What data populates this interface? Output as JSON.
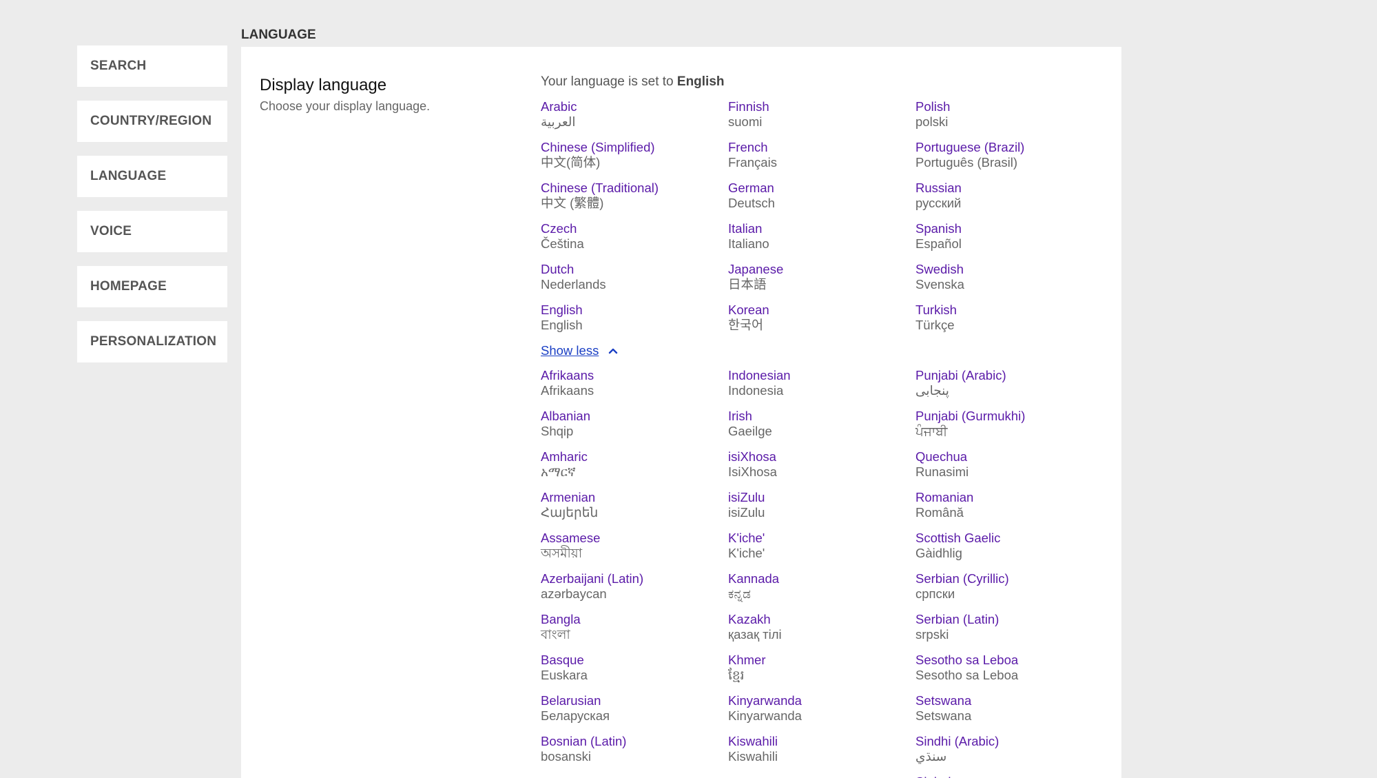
{
  "sidebar": {
    "items": [
      {
        "label": "SEARCH"
      },
      {
        "label": "COUNTRY/REGION"
      },
      {
        "label": "LANGUAGE"
      },
      {
        "label": "VOICE"
      },
      {
        "label": "HOMEPAGE"
      },
      {
        "label": "PERSONALIZATION"
      }
    ]
  },
  "section_label": "LANGUAGE",
  "panel": {
    "title": "Display language",
    "subtitle": "Choose your display language.",
    "status_prefix": "Your language is set to ",
    "status_value": "English"
  },
  "show_less_label": "Show less",
  "colors": {
    "background": "#ececec",
    "link": "#5a1aa8",
    "show_less": "#1a3fc4"
  },
  "primary_languages": [
    [
      {
        "name": "Arabic",
        "native": "العربية"
      },
      {
        "name": "Chinese (Simplified)",
        "native": "中文(简体)"
      },
      {
        "name": "Chinese (Traditional)",
        "native": "中文 (繁體)"
      },
      {
        "name": "Czech",
        "native": "Čeština"
      },
      {
        "name": "Dutch",
        "native": "Nederlands"
      },
      {
        "name": "English",
        "native": "English"
      }
    ],
    [
      {
        "name": "Finnish",
        "native": "suomi"
      },
      {
        "name": "French",
        "native": "Français"
      },
      {
        "name": "German",
        "native": "Deutsch"
      },
      {
        "name": "Italian",
        "native": "Italiano"
      },
      {
        "name": "Japanese",
        "native": "日本語"
      },
      {
        "name": "Korean",
        "native": "한국어"
      }
    ],
    [
      {
        "name": "Polish",
        "native": "polski"
      },
      {
        "name": "Portuguese (Brazil)",
        "native": "Português (Brasil)"
      },
      {
        "name": "Russian",
        "native": "русский"
      },
      {
        "name": "Spanish",
        "native": "Español"
      },
      {
        "name": "Swedish",
        "native": "Svenska"
      },
      {
        "name": "Turkish",
        "native": "Türkçe"
      }
    ]
  ],
  "more_languages": [
    [
      {
        "name": "Afrikaans",
        "native": "Afrikaans"
      },
      {
        "name": "Albanian",
        "native": "Shqip"
      },
      {
        "name": "Amharic",
        "native": "አማርኛ"
      },
      {
        "name": "Armenian",
        "native": "Հայերեն"
      },
      {
        "name": "Assamese",
        "native": "অসমীয়া"
      },
      {
        "name": "Azerbaijani (Latin)",
        "native": "azərbaycan"
      },
      {
        "name": "Bangla",
        "native": "বাংলা"
      },
      {
        "name": "Basque",
        "native": "Euskara"
      },
      {
        "name": "Belarusian",
        "native": "Беларуская"
      },
      {
        "name": "Bosnian (Latin)",
        "native": "bosanski"
      }
    ],
    [
      {
        "name": "Indonesian",
        "native": "Indonesia"
      },
      {
        "name": "Irish",
        "native": "Gaeilge"
      },
      {
        "name": "isiXhosa",
        "native": "IsiXhosa"
      },
      {
        "name": "isiZulu",
        "native": "isiZulu"
      },
      {
        "name": "K'iche'",
        "native": "K'iche'"
      },
      {
        "name": "Kannada",
        "native": "ಕನ್ನಡ"
      },
      {
        "name": "Kazakh",
        "native": "қазақ тілі"
      },
      {
        "name": "Khmer",
        "native": "ខ្មែរ"
      },
      {
        "name": "Kinyarwanda",
        "native": "Kinyarwanda"
      },
      {
        "name": "Kiswahili",
        "native": "Kiswahili"
      }
    ],
    [
      {
        "name": "Punjabi (Arabic)",
        "native": "پنجابی"
      },
      {
        "name": "Punjabi (Gurmukhi)",
        "native": "ਪੰਜਾਬੀ"
      },
      {
        "name": "Quechua",
        "native": "Runasimi"
      },
      {
        "name": "Romanian",
        "native": "Română"
      },
      {
        "name": "Scottish Gaelic",
        "native": "Gàidhlig"
      },
      {
        "name": "Serbian (Cyrillic)",
        "native": "српски"
      },
      {
        "name": "Serbian (Latin)",
        "native": "srpski"
      },
      {
        "name": "Sesotho sa Leboa",
        "native": "Sesotho sa Leboa"
      },
      {
        "name": "Setswana",
        "native": "Setswana"
      },
      {
        "name": "Sindhi (Arabic)",
        "native": "سنڌي"
      },
      {
        "name": "Sinhala",
        "native": ""
      }
    ]
  ]
}
